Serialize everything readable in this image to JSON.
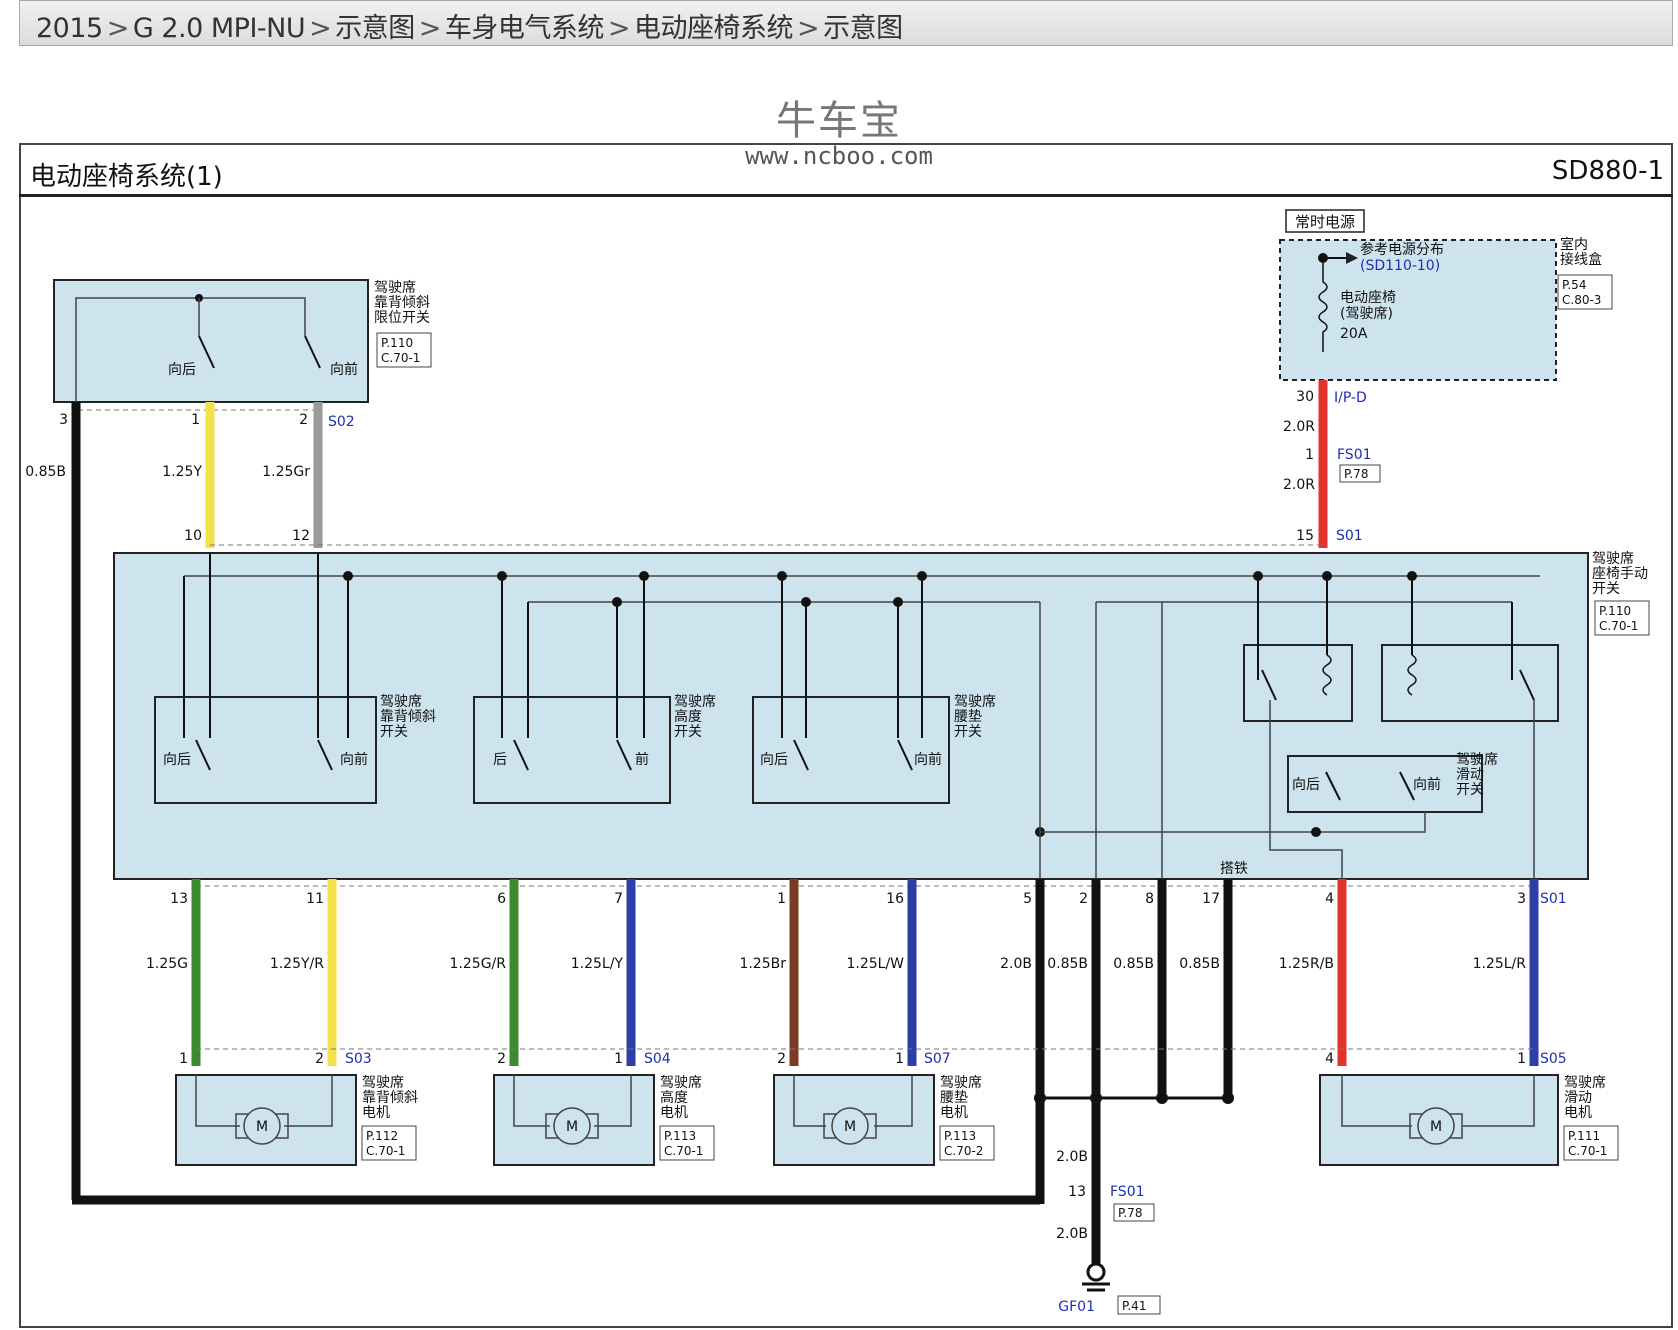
{
  "breadcrumb": {
    "items": [
      "2015",
      "G 2.0 MPI-NU",
      "示意图",
      "车身电气系统",
      "电动座椅系统",
      "示意图"
    ],
    "separator": ">"
  },
  "watermark": {
    "title": "牛车宝",
    "url": "www.ncboo.com"
  },
  "diagram": {
    "title": "电动座椅系统(1)",
    "code": "SD880-1",
    "power": {
      "label": "常时电源",
      "junction_box": [
        "室内",
        "接线盒"
      ],
      "junction_ref": [
        "P.54",
        "C.80-3"
      ],
      "ref_note": "参考电源分布",
      "ref_code": "(SD110-10)",
      "fuse_name": [
        "电动座椅",
        "(驾驶席)"
      ],
      "fuse_rating": "20A",
      "pin": "30",
      "connector": "I/P-D",
      "wire1": "2.0R",
      "fs_pin": "1",
      "fs_name": "FS01",
      "fs_ref": "P.78",
      "wire2": "2.0R",
      "main_pin": "15",
      "main_splice": "S01"
    },
    "recline_limit_switch": {
      "name": [
        "驾驶席",
        "靠背倾斜",
        "限位开关"
      ],
      "ref": [
        "P.110",
        "C.70-1"
      ],
      "back_label": "向后",
      "front_label": "向前",
      "pins": [
        "3",
        "1",
        "2"
      ],
      "splice": "S02"
    },
    "left_wires": {
      "ground_wire": "0.85B",
      "yellow_wire": "1.25Y",
      "gray_wire": "1.25Gr",
      "pin_a": "10",
      "pin_b": "12"
    },
    "main_switch": {
      "name": [
        "驾驶席",
        "座椅手动",
        "开关"
      ],
      "ref": [
        "P.110",
        "C.70-1"
      ],
      "sub_recline": {
        "name": [
          "驾驶席",
          "靠背倾斜",
          "开关"
        ],
        "left": "向后",
        "right": "向前"
      },
      "sub_height": {
        "name": [
          "驾驶席",
          "高度",
          "开关"
        ],
        "left": "后",
        "right": "前"
      },
      "sub_lumbar": {
        "name": [
          "驾驶席",
          "腰垫",
          "开关"
        ],
        "left": "向后",
        "right": "向前"
      },
      "sub_slide": {
        "name": [
          "驾驶席",
          "滑动",
          "开关"
        ],
        "left": "向后",
        "right": "向前"
      },
      "ground_label": "搭铁",
      "bottom_splice": "S01"
    },
    "bottom_wires": [
      {
        "pin": "13",
        "wire": "1.25G"
      },
      {
        "pin": "11",
        "wire": "1.25Y/R"
      },
      {
        "pin": "6",
        "wire": "1.25G/R"
      },
      {
        "pin": "7",
        "wire": "1.25L/Y"
      },
      {
        "pin": "1",
        "wire": "1.25Br"
      },
      {
        "pin": "16",
        "wire": "1.25L/W"
      },
      {
        "pin": "5",
        "wire": "2.0B"
      },
      {
        "pin": "2",
        "wire": "0.85B"
      },
      {
        "pin": "8",
        "wire": "0.85B"
      },
      {
        "pin": "17",
        "wire": "0.85B"
      },
      {
        "pin": "4",
        "wire": "1.25R/B"
      },
      {
        "pin": "3",
        "wire": "1.25L/R"
      }
    ],
    "motors": [
      {
        "name": [
          "驾驶席",
          "靠背倾斜",
          "电机"
        ],
        "ref": [
          "P.112",
          "C.70-1"
        ],
        "pins": [
          "1",
          "2"
        ],
        "splice": "S03",
        "symbol": "M"
      },
      {
        "name": [
          "驾驶席",
          "高度",
          "电机"
        ],
        "ref": [
          "P.113",
          "C.70-1"
        ],
        "pins": [
          "2",
          "1"
        ],
        "splice": "S04",
        "symbol": "M"
      },
      {
        "name": [
          "驾驶席",
          "腰垫",
          "电机"
        ],
        "ref": [
          "P.113",
          "C.70-2"
        ],
        "pins": [
          "2",
          "1"
        ],
        "splice": "S07",
        "symbol": "M"
      },
      {
        "name": [
          "驾驶席",
          "滑动",
          "电机"
        ],
        "ref": [
          "P.111",
          "C.70-1"
        ],
        "pins": [
          "4",
          "1"
        ],
        "splice": "S05",
        "symbol": "M"
      }
    ],
    "ground": {
      "wire_top": "2.0B",
      "pin": "13",
      "fs_name": "FS01",
      "fs_ref": "P.78",
      "wire_bottom": "2.0B",
      "point": "GF01",
      "point_ref": "P.41"
    },
    "colors": {
      "yellow": "#f4e04a",
      "gray": "#9a9a9a",
      "red": "#e0342d",
      "green": "#3c8a2e",
      "brown": "#7b3a26",
      "blue": "#2d3fa6",
      "black": "#111111",
      "panel": "#cde4ee"
    }
  }
}
